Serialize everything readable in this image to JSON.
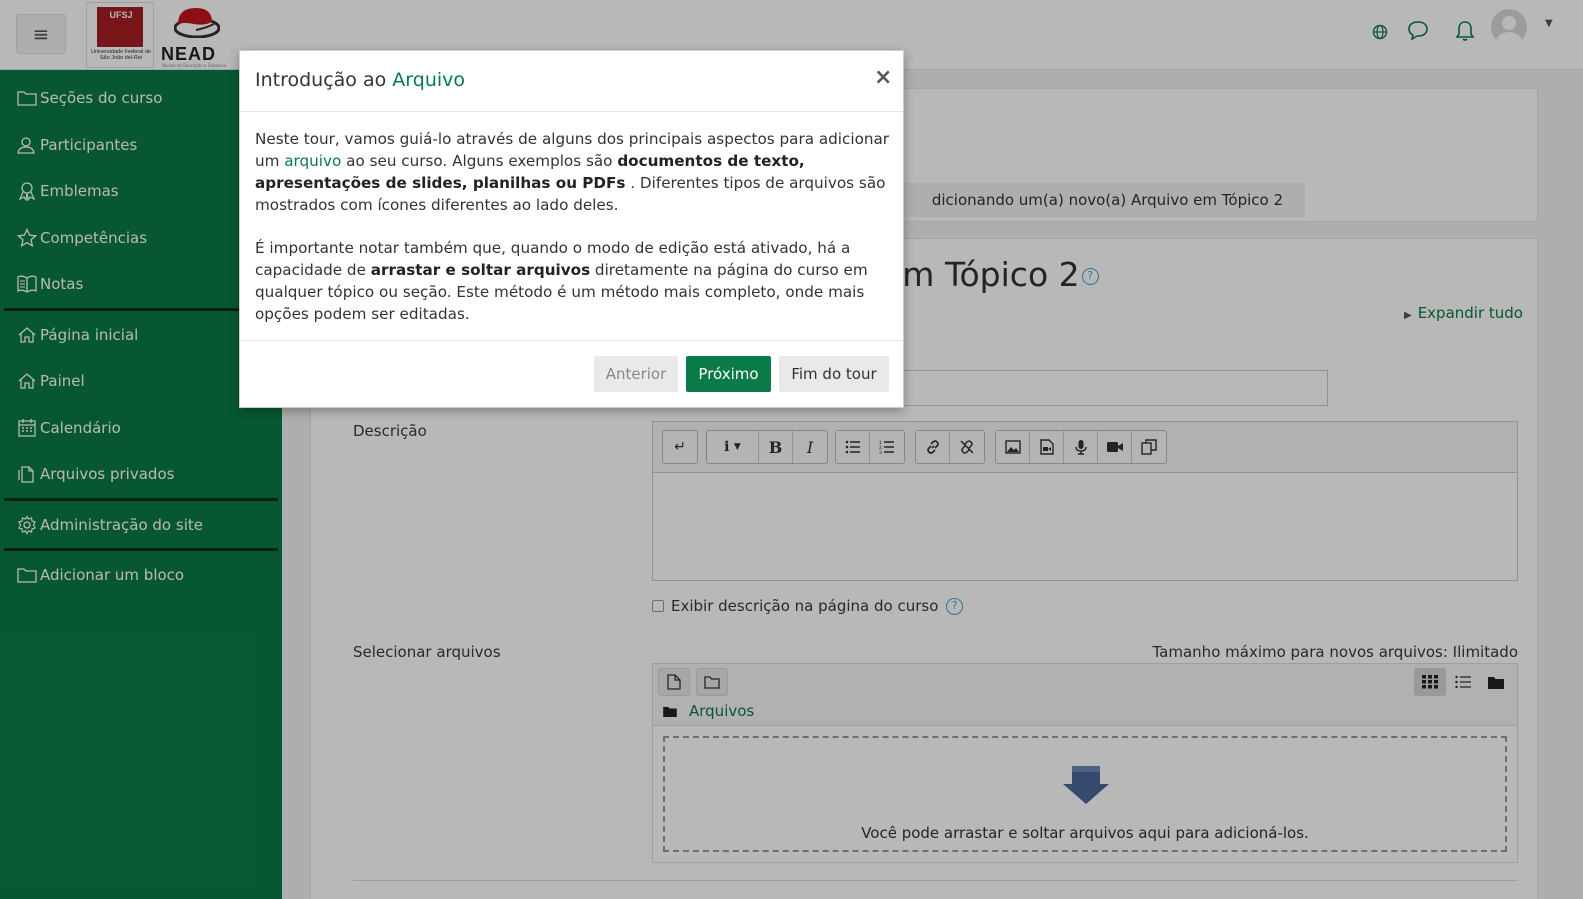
{
  "navbar": {
    "menu_icon": "hamburger-icon",
    "logo_ufsj_short": "UFSJ",
    "logo_ufsj_full": "Universidade Federal de São João del-Rei",
    "logo_nead": "NEAD",
    "logo_nead_sub": "Núcleo de Educação a Distância",
    "icons": [
      "globe-icon",
      "chat-bubble-icon",
      "bell-icon",
      "user-avatar"
    ]
  },
  "sidebar": {
    "items": [
      {
        "label": "Seções do curso",
        "icon": "folder-icon"
      },
      {
        "label": "Participantes",
        "icon": "users-icon"
      },
      {
        "label": "Emblemas",
        "icon": "badge-icon"
      },
      {
        "label": "Competências",
        "icon": "star-icon"
      },
      {
        "label": "Notas",
        "icon": "gradebook-icon"
      },
      {
        "label": "Página inicial",
        "icon": "home-icon"
      },
      {
        "label": "Painel",
        "icon": "home-icon"
      },
      {
        "label": "Calendário",
        "icon": "calendar-icon"
      },
      {
        "label": "Arquivos privados",
        "icon": "file-icon"
      },
      {
        "label": "Administração do site",
        "icon": "gear-icon"
      },
      {
        "label": "Adicionar um bloco",
        "icon": "folder-icon"
      }
    ]
  },
  "page": {
    "breadcrumb_visible": "dicionando um(a) novo(a) Arquivo em Tópico 2",
    "heading_visible": "em Tópico 2",
    "expand_all": "Expandir tudo",
    "description_label": "Descrição",
    "show_description_label": "Exibir descrição na página do curso",
    "select_files_label": "Selecionar arquivos",
    "max_size": "Tamanho máximo para novos arquivos: Ilimitado",
    "files_folder": "Arquivos",
    "drop_text": "Você pode arrastar e soltar arquivos aqui para adicioná-los."
  },
  "editor": {
    "toolbar_groups": [
      [
        "collapse-icon"
      ],
      [
        "info-icon",
        "bold-icon",
        "italic-icon"
      ],
      [
        "unordered-list-icon",
        "ordered-list-icon"
      ],
      [
        "link-icon",
        "unlink-icon"
      ],
      [
        "image-icon",
        "media-icon",
        "microphone-icon",
        "video-icon",
        "copy-icon"
      ]
    ],
    "bold_glyph": "B",
    "italic_glyph": "I"
  },
  "tour": {
    "title_prefix": "Introdução ao ",
    "title_highlight": "Arquivo",
    "close": "×",
    "p1_a": "Neste tour, vamos guiá-lo através de alguns dos principais aspectos para adicionar um ",
    "p1_link": "arquivo",
    "p1_b": " ao seu curso. Alguns exemplos são ",
    "p1_bold": "documentos de texto, apresentações de slides, planilhas ou PDFs",
    "p1_c": " . Diferentes tipos de arquivos são mostrados com ícones diferentes ao lado deles.",
    "p2_a": "É importante notar também que, quando o modo de edição está ativado, há a capacidade de ",
    "p2_bold": "arrastar e soltar arquivos",
    "p2_b": " diretamente na página do curso em qualquer tópico ou seção. Este método é um método mais completo, onde mais opções podem ser editadas.",
    "btn_prev": "Anterior",
    "btn_next": "Próximo",
    "btn_end": "Fim do tour"
  },
  "colors": {
    "brand_green": "#0a7a46",
    "sidebar_divider": "#062f1c",
    "help_blue": "#4aa3c9"
  }
}
